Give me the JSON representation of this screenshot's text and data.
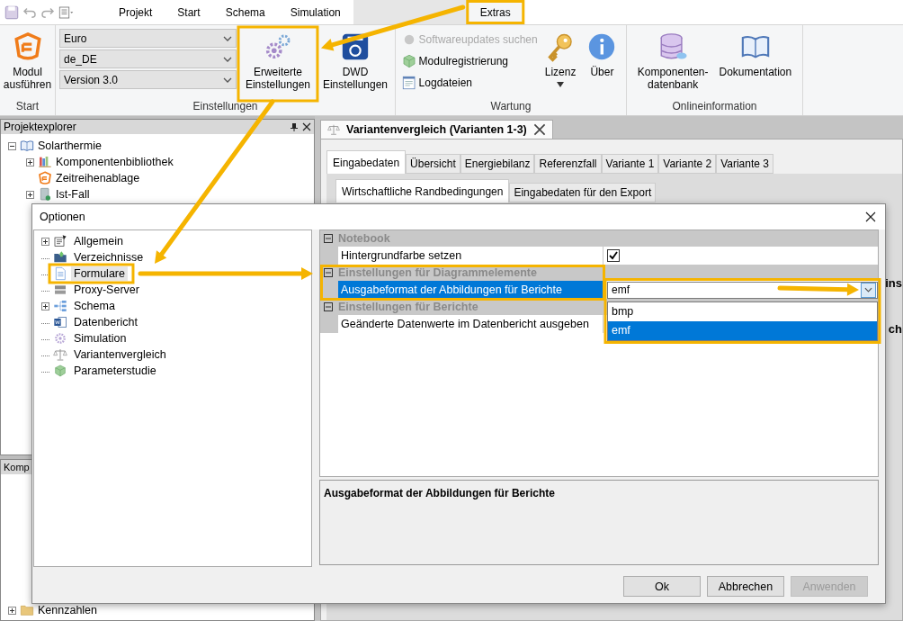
{
  "ribbon": {
    "tabs": [
      {
        "label": "Projekt",
        "selected": false
      },
      {
        "label": "Start",
        "selected": false
      },
      {
        "label": "Schema",
        "selected": false
      },
      {
        "label": "Simulation",
        "selected": false
      },
      {
        "label": "Extras",
        "selected": true
      }
    ],
    "groups": [
      {
        "label": "Start",
        "items": [
          {
            "kind": "large",
            "label": "Modul ausführen"
          }
        ]
      },
      {
        "label": "Einstellungen",
        "items": [
          {
            "kind": "combos",
            "values": [
              "Euro",
              "de_DE",
              "Version 3.0"
            ]
          },
          {
            "kind": "large",
            "label": "Erweiterte Einstellungen"
          },
          {
            "kind": "large",
            "label": "DWD Einstellungen"
          }
        ]
      },
      {
        "label": "Wartung",
        "items": [
          {
            "kind": "small",
            "entries": [
              {
                "label": "Softwareupdates suchen",
                "disabled": true
              },
              {
                "label": "Modulregistrierung",
                "disabled": false
              },
              {
                "label": "Logdateien",
                "disabled": false
              }
            ]
          },
          {
            "kind": "large",
            "label": "Lizenz",
            "dropdown": true
          },
          {
            "kind": "large",
            "label": "Über"
          }
        ]
      },
      {
        "label": "Onlineinformation",
        "items": [
          {
            "kind": "large",
            "label": "Komponenten-\ndatenbank"
          },
          {
            "kind": "large",
            "label": "Dokumentation"
          }
        ]
      }
    ]
  },
  "project_explorer": {
    "title": "Projektexplorer",
    "tree": [
      {
        "label": "Solarthermie",
        "expanded": true,
        "children": [
          {
            "label": "Komponentenbibliothek",
            "expanded": false
          },
          {
            "label": "Zeitreihenablage"
          },
          {
            "label": "Ist-Fall",
            "expanded": false
          }
        ]
      }
    ]
  },
  "components_panel": {
    "title": "Komp",
    "items": [
      {
        "label": "Kennzahlen",
        "expanded": false
      }
    ]
  },
  "document": {
    "tab": {
      "title": "Variantenvergleich (Varianten 1-3)"
    },
    "tabs": [
      {
        "label": "Eingabedaten",
        "selected": true
      },
      {
        "label": "Übersicht",
        "selected": false
      },
      {
        "label": "Energiebilanz",
        "selected": false
      },
      {
        "label": "Referenzfall",
        "selected": false
      },
      {
        "label": "Variante 1",
        "selected": false
      },
      {
        "label": "Variante 2",
        "selected": false
      },
      {
        "label": "Variante 3",
        "selected": false
      }
    ],
    "subtabs": [
      {
        "label": "Wirtschaftliche Randbedingungen",
        "selected": true
      },
      {
        "label": "Eingabedaten für den Export",
        "selected": false
      }
    ],
    "fragments": [
      "ins",
      "ch"
    ]
  },
  "dialog": {
    "title": "Optionen",
    "tree": [
      {
        "label": "Allgemein",
        "expandable": true,
        "selected": false
      },
      {
        "label": "Verzeichnisse",
        "expandable": false,
        "selected": false
      },
      {
        "label": "Formulare",
        "expandable": false,
        "selected": true
      },
      {
        "label": "Proxy-Server",
        "expandable": false,
        "selected": false
      },
      {
        "label": "Schema",
        "expandable": true,
        "selected": false
      },
      {
        "label": "Datenbericht",
        "expandable": false,
        "selected": false
      },
      {
        "label": "Simulation",
        "expandable": false,
        "selected": false
      },
      {
        "label": "Variantenvergleich",
        "expandable": false,
        "selected": false
      },
      {
        "label": "Parameterstudie",
        "expandable": false,
        "selected": false
      }
    ],
    "categories": [
      {
        "label": "Notebook",
        "expanded": true,
        "rows": [
          {
            "name": "Hintergrundfarbe setzen",
            "kind": "checkbox",
            "checked": true,
            "selected": false
          }
        ]
      },
      {
        "label": "Einstellungen für Diagrammelemente",
        "expanded": true,
        "rows": [
          {
            "name": "Ausgabeformat der Abbildungen für Berichte",
            "kind": "dropdown",
            "value": "emf",
            "open": true,
            "selected": true,
            "options": [
              {
                "label": "bmp",
                "selected": false
              },
              {
                "label": "emf",
                "selected": true
              }
            ]
          }
        ]
      },
      {
        "label": "Einstellungen für Berichte",
        "expanded": true,
        "rows": [
          {
            "name": "Geänderte Datenwerte im Datenbericht ausgeben",
            "kind": "plain",
            "selected": false
          }
        ]
      }
    ],
    "description": "Ausgabeformat der Abbildungen für Berichte",
    "buttons": [
      {
        "label": "Ok",
        "disabled": false
      },
      {
        "label": "Abbrechen",
        "disabled": false
      },
      {
        "label": "Anwenden",
        "disabled": true
      }
    ]
  }
}
